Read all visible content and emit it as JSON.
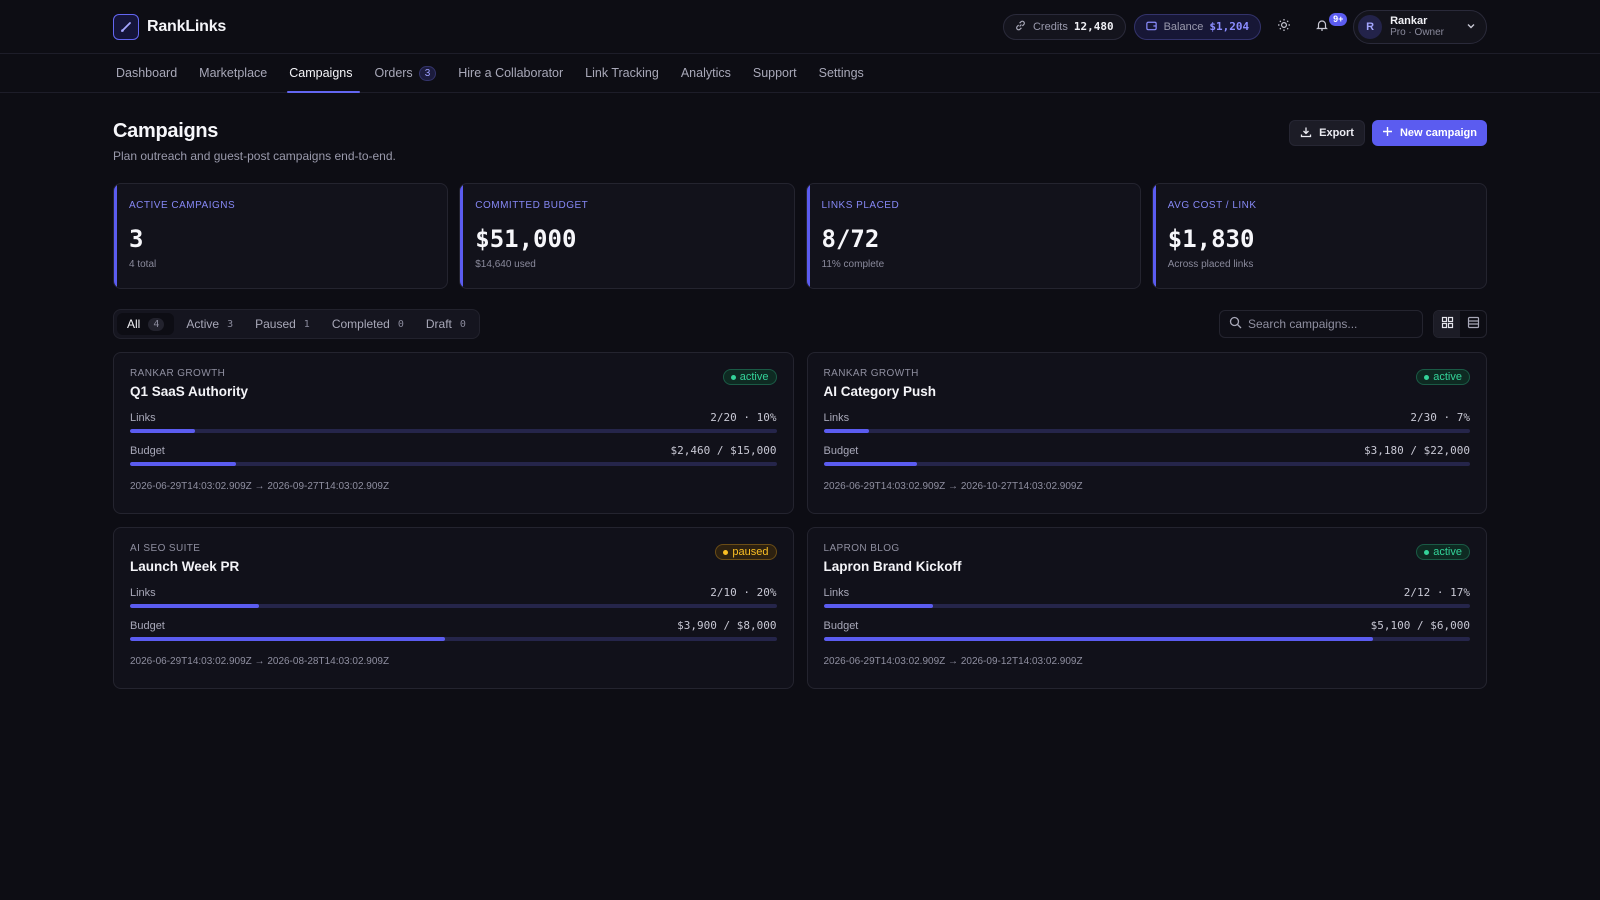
{
  "app": {
    "name": "RankLinks"
  },
  "header": {
    "credits_label": "Credits",
    "credits_value": "12,480",
    "balance_label": "Balance",
    "balance_value": "$1,204",
    "notifications_badge": "9+",
    "user": {
      "initial": "R",
      "name": "Rankar",
      "role": "Pro · Owner"
    }
  },
  "nav": {
    "items": [
      {
        "label": "Dashboard"
      },
      {
        "label": "Marketplace"
      },
      {
        "label": "Campaigns",
        "active": true
      },
      {
        "label": "Orders",
        "count": "3"
      },
      {
        "label": "Hire a Collaborator"
      },
      {
        "label": "Link Tracking"
      },
      {
        "label": "Analytics"
      },
      {
        "label": "Support"
      },
      {
        "label": "Settings"
      }
    ]
  },
  "page": {
    "title": "Campaigns",
    "subtitle": "Plan outreach and guest-post campaigns end-to-end.",
    "export_label": "Export",
    "new_label": "New campaign"
  },
  "stats": [
    {
      "label": "Active campaigns",
      "value": "3",
      "note": "4 total"
    },
    {
      "label": "Committed budget",
      "value": "$51,000",
      "note": "$14,640 used"
    },
    {
      "label": "Links placed",
      "value": "8/72",
      "note": "11% complete"
    },
    {
      "label": "Avg cost / link",
      "value": "$1,830",
      "note": "Across placed links"
    }
  ],
  "filters": [
    {
      "label": "All",
      "count": "4",
      "active": true
    },
    {
      "label": "Active",
      "count": "3"
    },
    {
      "label": "Paused",
      "count": "1"
    },
    {
      "label": "Completed",
      "count": "0"
    },
    {
      "label": "Draft",
      "count": "0"
    }
  ],
  "search": {
    "placeholder": "Search campaigns...",
    "value": ""
  },
  "view": {
    "selected": "grid"
  },
  "campaigns": [
    {
      "client": "Rankar Growth",
      "title": "Q1 SaaS Authority",
      "status": "active",
      "links_label": "Links",
      "links_text": "2/20 · 10%",
      "links_progress": 0.1,
      "budget_label": "Budget",
      "budget_text": "$2,460 / $15,000",
      "budget_progress": 0.164,
      "dates": "2026-06-29T14:03:02.909Z → 2026-09-27T14:03:02.909Z"
    },
    {
      "client": "Rankar Growth",
      "title": "AI Category Push",
      "status": "active",
      "links_label": "Links",
      "links_text": "2/30 · 7%",
      "links_progress": 0.07,
      "budget_label": "Budget",
      "budget_text": "$3,180 / $22,000",
      "budget_progress": 0.1445,
      "dates": "2026-06-29T14:03:02.909Z → 2026-10-27T14:03:02.909Z"
    },
    {
      "client": "AI SEO Suite",
      "title": "Launch Week PR",
      "status": "paused",
      "links_label": "Links",
      "links_text": "2/10 · 20%",
      "links_progress": 0.2,
      "budget_label": "Budget",
      "budget_text": "$3,900 / $8,000",
      "budget_progress": 0.4875,
      "dates": "2026-06-29T14:03:02.909Z → 2026-08-28T14:03:02.909Z"
    },
    {
      "client": "Lapron Blog",
      "title": "Lapron Brand Kickoff",
      "status": "active",
      "links_label": "Links",
      "links_text": "2/12 · 17%",
      "links_progress": 0.17,
      "budget_label": "Budget",
      "budget_text": "$5,100 / $6,000",
      "budget_progress": 0.85,
      "dates": "2026-06-29T14:03:02.909Z → 2026-09-12T14:03:02.909Z"
    }
  ],
  "colors": {
    "background": "#0d0d14",
    "accent": "#5b5cf0",
    "status_active": "#34d399",
    "status_paused": "#fbbf24"
  }
}
